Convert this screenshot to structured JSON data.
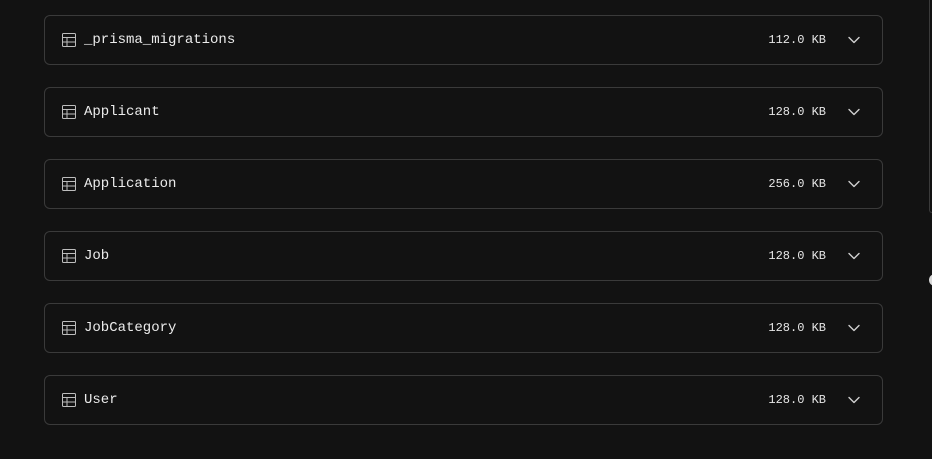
{
  "tables": [
    {
      "name": "_prisma_migrations",
      "size": "112.0 KB",
      "icon": "table-icon",
      "action_icon": "chevron-down-icon"
    },
    {
      "name": "Applicant",
      "size": "128.0 KB",
      "icon": "table-icon",
      "action_icon": "chevron-down-icon"
    },
    {
      "name": "Application",
      "size": "256.0 KB",
      "icon": "table-icon",
      "action_icon": "chevron-down-icon"
    },
    {
      "name": "Job",
      "size": "128.0 KB",
      "icon": "table-icon",
      "action_icon": "chevron-down-icon"
    },
    {
      "name": "JobCategory",
      "size": "128.0 KB",
      "icon": "table-icon",
      "action_icon": "chevron-down-icon"
    },
    {
      "name": "User",
      "size": "128.0 KB",
      "icon": "table-icon",
      "action_icon": "chevron-down-icon"
    }
  ],
  "colors": {
    "background": "#121212",
    "border": "#3a3a3a",
    "text": "#ececec"
  }
}
